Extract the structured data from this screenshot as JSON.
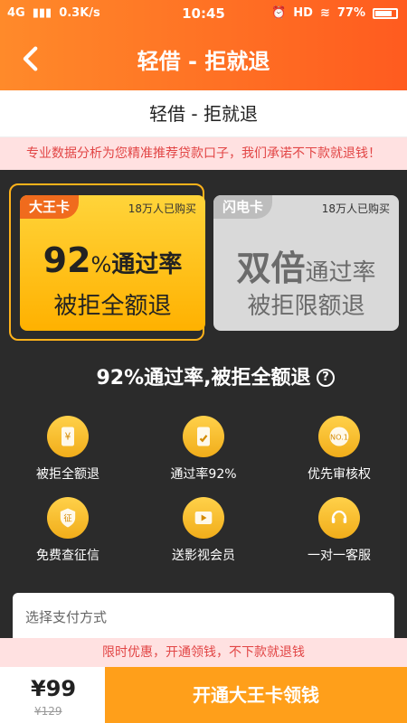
{
  "status_bar": {
    "network": "4G",
    "speed": "0.3K/s",
    "time": "10:45",
    "hd": "HD",
    "battery": "77%"
  },
  "header": {
    "title": "轻借 - 拒就退",
    "back_icon": "chevron-left-icon"
  },
  "subtitle": "轻借 - 拒就退",
  "notice": "专业数据分析为您精准推荐贷款口子，我们承诺不下款就退钱！",
  "cards": {
    "gold": {
      "tag": "大王卡",
      "buyers": "18万人已购买",
      "line1_big": "92",
      "line1_small": "%",
      "line1_rest": "通过率",
      "line2": "被拒全额退"
    },
    "gray": {
      "tag": "闪电卡",
      "buyers": "18万人已购买",
      "line1_big": "双倍",
      "line1_rest": "通过率",
      "line2": "被拒限额退"
    }
  },
  "benefits_title": "92%通过率,被拒全额退",
  "help": "?",
  "benefits": [
    {
      "label": "被拒全额退",
      "icon": "receipt-icon"
    },
    {
      "label": "通过率92%",
      "icon": "document-check-icon"
    },
    {
      "label": "优先审核权",
      "icon": "no1-badge-icon"
    },
    {
      "label": "免费查征信",
      "icon": "credit-shield-icon"
    },
    {
      "label": "送影视会员",
      "icon": "tv-icon"
    },
    {
      "label": "一对一客服",
      "icon": "headset-icon"
    }
  ],
  "payment": {
    "label": "选择支付方式"
  },
  "promo": "限时优惠，开通领钱，不下款就退钱",
  "bottom": {
    "price": "¥99",
    "orig_price": "¥129",
    "cta": "开通大王卡领钱"
  },
  "colors": {
    "accent": "#ff9f1a",
    "header_left": "#ff8a2a",
    "header_right": "#ff5b1f",
    "notice_bg": "#ffe1e1",
    "notice_text": "#e24545"
  }
}
